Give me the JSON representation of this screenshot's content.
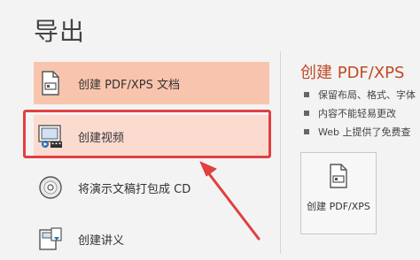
{
  "page": {
    "title": "导出"
  },
  "export_options": [
    {
      "label": "创建 PDF/XPS 文档",
      "icon": "pdf-document-icon",
      "state": "hover"
    },
    {
      "label": "创建视频",
      "icon": "video-icon",
      "state": "highlighted"
    },
    {
      "label": "将演示文稿打包成 CD",
      "icon": "cd-icon",
      "state": "normal"
    },
    {
      "label": "创建讲义",
      "icon": "handout-icon",
      "state": "normal"
    }
  ],
  "detail": {
    "title": "创建 PDF/XPS",
    "bullets": [
      "保留布局、格式、字体",
      "内容不能轻易更改",
      "Web 上提供了免费查"
    ],
    "button_label": "创建 PDF/XPS"
  },
  "annotation": {
    "highlight_color": "#e04040",
    "arrow_color": "#e04040"
  },
  "colors": {
    "accent": "#c04a24",
    "hover_bg": "#f9c4ad",
    "selected_bg": "#fbdbd0"
  }
}
